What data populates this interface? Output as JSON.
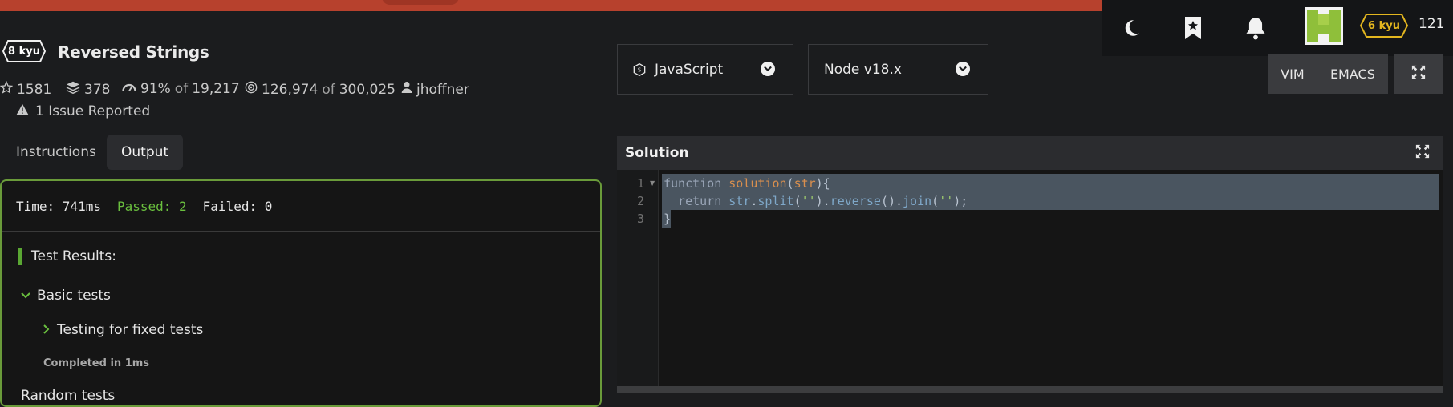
{
  "topbar": {
    "icons": [
      "moon-icon",
      "bookmark-star-icon",
      "bell-icon"
    ],
    "rank_badge": "6 kyu",
    "honor": "121"
  },
  "kata": {
    "rank": "8 kyu",
    "title": "Reversed Strings",
    "stats": {
      "stars": "1581",
      "collections": "378",
      "satisfaction": "91%",
      "satisfaction_of": "of",
      "satisfaction_total": "19,217",
      "completions": "126,974",
      "completions_of": "of",
      "completions_total": "300,025",
      "author": "jhoffner"
    },
    "issues": "1 Issue Reported"
  },
  "tabs": {
    "instructions": "Instructions",
    "output": "Output"
  },
  "output": {
    "time": "Time: 741ms",
    "passed": "Passed: 2",
    "failed": "Failed: 0",
    "results_title": "Test Results:",
    "basic_tests": "Basic tests",
    "fixed_tests": "Testing for fixed tests",
    "completed": "Completed in 1ms",
    "random_tests": "Random tests"
  },
  "editor": {
    "language": "JavaScript",
    "version": "Node v18.x",
    "mode_vim": "VIM",
    "mode_emacs": "EMACS",
    "solution_title": "Solution",
    "line_numbers": [
      "1",
      "2",
      "3"
    ],
    "code": {
      "l1_kw": "function",
      "l1_fn": "solution",
      "l1_p1": "(",
      "l1_arg": "str",
      "l1_p2": "){",
      "l2_kw": "  return",
      "l2_var": " str",
      "l2_dot1": ".",
      "l2_split": "split",
      "l2_a1": "(",
      "l2_s1": "''",
      "l2_a2": ").",
      "l2_rev": "reverse",
      "l2_a3": "().",
      "l2_join": "join",
      "l2_a4": "(",
      "l2_s2": "''",
      "l2_a5": ");",
      "l3": "}"
    }
  },
  "colors": {
    "banner": "#b7412d",
    "passed": "#6abf3e",
    "output_border": "#6a9b3a",
    "rank_yellow": "#e3b61f"
  }
}
